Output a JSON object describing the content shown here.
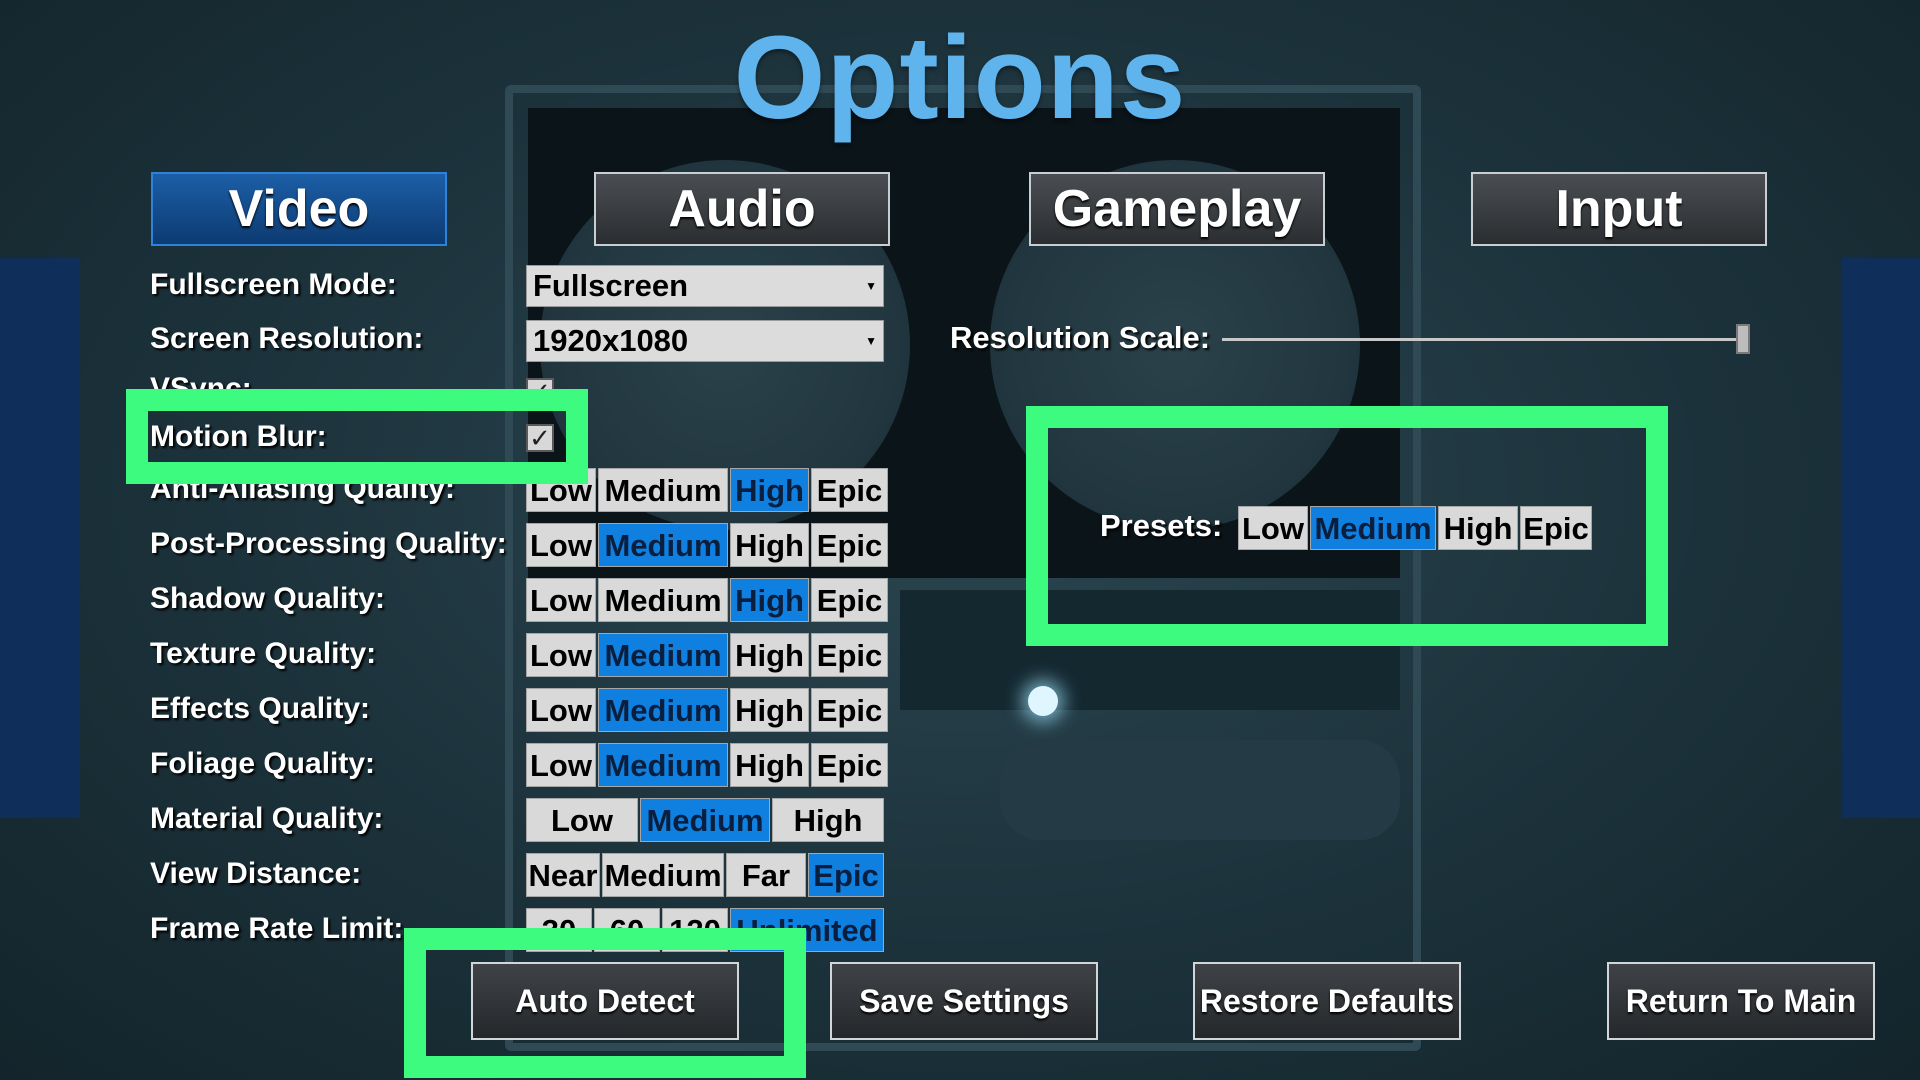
{
  "title": "Options",
  "tabs": [
    {
      "label": "Video",
      "active": true
    },
    {
      "label": "Audio",
      "active": false
    },
    {
      "label": "Gameplay",
      "active": false
    },
    {
      "label": "Input",
      "active": false
    }
  ],
  "video": {
    "fullscreen_mode": {
      "label": "Fullscreen Mode:",
      "value": "Fullscreen"
    },
    "screen_resolution": {
      "label": "Screen Resolution:",
      "value": "1920x1080"
    },
    "vsync": {
      "label": "VSync:",
      "checked": true
    },
    "motion_blur": {
      "label": "Motion Blur:",
      "checked": true
    },
    "quality_rows": [
      {
        "label": "Anti-Aliasing Quality:",
        "options": [
          "Low",
          "Medium",
          "High",
          "Epic"
        ],
        "selected": "High"
      },
      {
        "label": "Post-Processing Quality:",
        "options": [
          "Low",
          "Medium",
          "High",
          "Epic"
        ],
        "selected": "Medium"
      },
      {
        "label": "Shadow Quality:",
        "options": [
          "Low",
          "Medium",
          "High",
          "Epic"
        ],
        "selected": "High"
      },
      {
        "label": "Texture Quality:",
        "options": [
          "Low",
          "Medium",
          "High",
          "Epic"
        ],
        "selected": "Medium"
      },
      {
        "label": "Effects Quality:",
        "options": [
          "Low",
          "Medium",
          "High",
          "Epic"
        ],
        "selected": "Medium"
      },
      {
        "label": "Foliage Quality:",
        "options": [
          "Low",
          "Medium",
          "High",
          "Epic"
        ],
        "selected": "Medium"
      }
    ],
    "material_quality": {
      "label": "Material Quality:",
      "options": [
        "Low",
        "Medium",
        "High"
      ],
      "selected": "Medium"
    },
    "view_distance": {
      "label": "View Distance:",
      "options": [
        "Near",
        "Medium",
        "Far",
        "Epic"
      ],
      "selected": "Epic"
    },
    "frame_rate_limit": {
      "label": "Frame Rate Limit:",
      "options": [
        "30",
        "60",
        "120",
        "Unlimited"
      ],
      "selected": "Unlimited"
    },
    "resolution_scale": {
      "label": "Resolution Scale:",
      "value_fraction": 1.0
    },
    "presets": {
      "label": "Presets:",
      "options": [
        "Low",
        "Medium",
        "High",
        "Epic"
      ],
      "selected": "Medium"
    }
  },
  "buttons": {
    "auto_detect": "Auto Detect",
    "save_settings": "Save Settings",
    "restore_defaults": "Restore Defaults",
    "return_to_main": "Return To Main"
  },
  "colors": {
    "title": "#5fb4ee",
    "selected_option": "#0f7fe0",
    "highlight": "#3dfb7e",
    "active_tab": "#1c5ea6"
  }
}
